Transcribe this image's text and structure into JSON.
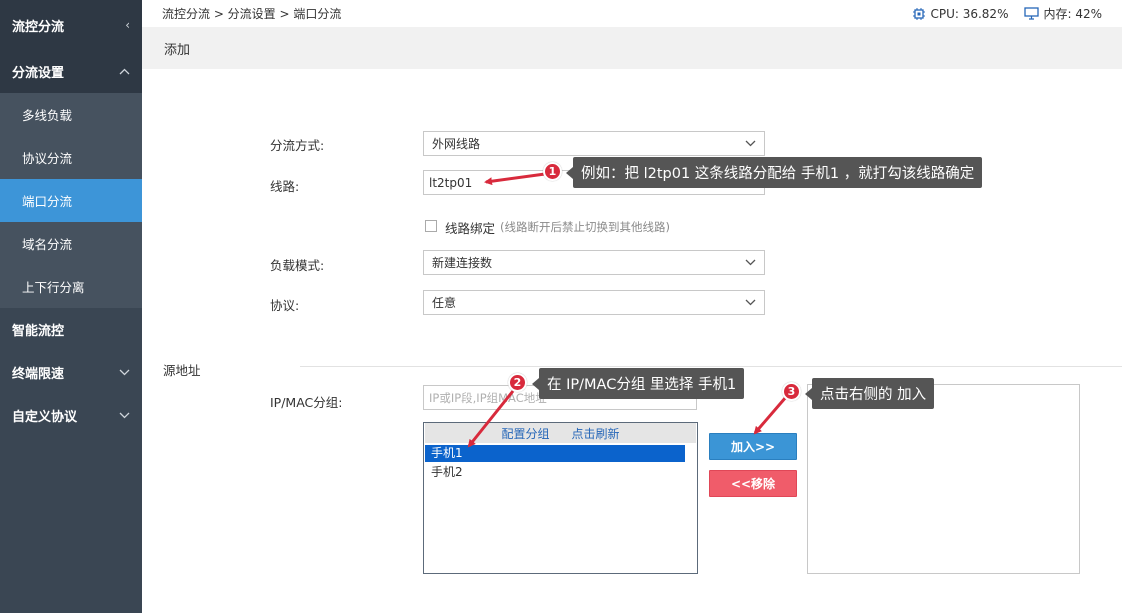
{
  "sidebar": {
    "top_label": "流控分流",
    "top_chevron": "‹",
    "group_label": "分流设置",
    "group_chevron": "ˆ",
    "sub_items": [
      {
        "label": "多线负载"
      },
      {
        "label": "协议分流"
      },
      {
        "label": "端口分流"
      },
      {
        "label": "域名分流"
      },
      {
        "label": "上下行分离"
      }
    ],
    "items": [
      {
        "label": "智能流控"
      },
      {
        "label": "终端限速"
      },
      {
        "label": "自定义协议"
      }
    ]
  },
  "topbar": {
    "breadcrumb": "流控分流 > 分流设置 > 端口分流",
    "cpu": "CPU: 36.82%",
    "memory": "内存: 42%"
  },
  "subbar": {
    "title": "添加"
  },
  "form": {
    "mode_label": "分流方式:",
    "mode_value": "外网线路",
    "line_label": "线路:",
    "line_value": "lt2tp01",
    "bind_label": "线路绑定",
    "bind_hint": "(线路断开后禁止切换到其他线路)",
    "load_label": "负载模式:",
    "load_value": "新建连接数",
    "protocol_label": "协议:",
    "protocol_value": "任意",
    "source_label": "源地址",
    "ipmac_label": "IP/MAC分组:",
    "ipmac_placeholder": "IP或IP段,IP组MAC地址",
    "config_group": "配置分组",
    "refresh": "点击刷新",
    "groups": [
      "手机1",
      "手机2"
    ],
    "add_button": "加入>>",
    "remove_button": "<<移除"
  },
  "callouts": [
    {
      "num": "1",
      "text": "例如：把 l2tp01 这条线路分配给 手机1 ，就打勾该线路确定"
    },
    {
      "num": "2",
      "text": "在 IP/MAC分组 里选择 手机1"
    },
    {
      "num": "3",
      "text": "点击右侧的 加入"
    }
  ],
  "colors": {
    "sidebar": "#3a4653",
    "active": "#3d95d8",
    "selected": "#0b63cc",
    "add": "#3b95d6",
    "remove": "#f05c6a",
    "badge": "#d82a3c"
  }
}
